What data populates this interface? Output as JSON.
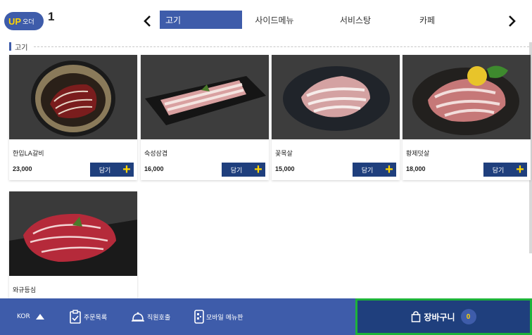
{
  "header": {
    "logo_up": "UP",
    "logo_order": "오더",
    "table_number": "1",
    "tabs": [
      {
        "label": "고기",
        "active": true
      },
      {
        "label": "사이드메뉴",
        "active": false
      },
      {
        "label": "서비스탕",
        "active": false
      },
      {
        "label": "카페",
        "active": false
      }
    ]
  },
  "section": {
    "title": "고기"
  },
  "products": [
    {
      "name": "한입LA갈비",
      "price": "23,000",
      "add_label": "담기",
      "image": "la-galbi-photo"
    },
    {
      "name": "숙성삼겹",
      "price": "16,000",
      "add_label": "담기",
      "image": "pork-belly-photo"
    },
    {
      "name": "꽃목살",
      "price": "15,000",
      "add_label": "담기",
      "image": "pork-neck-photo"
    },
    {
      "name": "황제덧살",
      "price": "18,000",
      "add_label": "담기",
      "image": "pork-special-photo"
    },
    {
      "name": "와규등심",
      "price": "",
      "add_label": "",
      "image": "wagyu-sirloin-photo"
    }
  ],
  "bottom_bar": {
    "language": "KOR",
    "orders_label": "주문목록",
    "staff_call_label": "직원호출",
    "mobile_menu_label": "모바일 메뉴판",
    "cart_label": "장바구니",
    "cart_count": "0"
  },
  "colors": {
    "brand_blue": "#3e5caa",
    "dark_blue": "#1f3f7d",
    "accent_yellow": "#ffd400",
    "highlight_green": "#1db33a"
  }
}
